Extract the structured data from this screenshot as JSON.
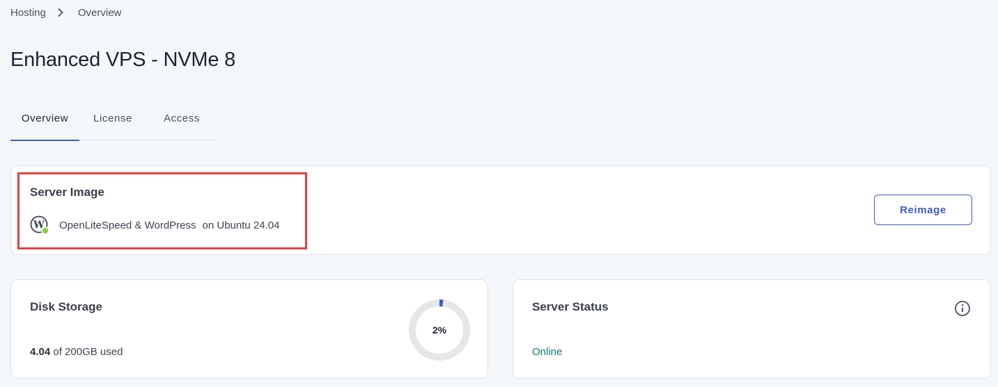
{
  "breadcrumb": {
    "items": [
      "Hosting",
      "Overview"
    ],
    "separator_icon": "chevron-right-icon"
  },
  "page": {
    "title": "Enhanced VPS - NVMe 8"
  },
  "tabs": [
    {
      "label": "Overview",
      "active": true
    },
    {
      "label": "License",
      "active": false
    },
    {
      "label": "Access",
      "active": false
    }
  ],
  "server_image": {
    "title": "Server Image",
    "icon": "wordpress-icon",
    "name": "OpenLiteSpeed & WordPress",
    "os": "on Ubuntu 24.04",
    "reimage_label": "Reimage"
  },
  "disk_storage": {
    "title": "Disk Storage",
    "used": "4.04",
    "total_text": "of 200GB used",
    "percent_label": "2%",
    "percent": 2
  },
  "server_status": {
    "title": "Server Status",
    "value": "Online",
    "info_icon": "info-icon"
  },
  "colors": {
    "accent": "#3b5bc8",
    "highlight": "#e5403f",
    "online": "#0f7a6b",
    "background": "#f5f8fb"
  }
}
